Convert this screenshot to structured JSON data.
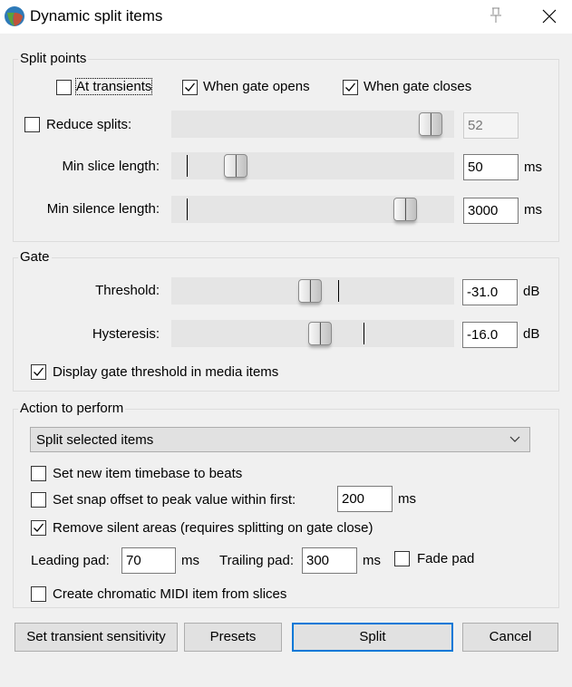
{
  "window": {
    "title": "Dynamic split items",
    "app_icon": "reaper-logo-icon",
    "pin_icon": "pin-icon",
    "close_icon": "close-icon"
  },
  "split_points": {
    "label": "Split points",
    "at_transients": {
      "label": "At transients",
      "checked": false
    },
    "when_gate_opens": {
      "label": "When gate opens",
      "checked": true
    },
    "when_gate_closes": {
      "label": "When gate closes",
      "checked": true
    },
    "reduce_splits": {
      "label": "Reduce splits:",
      "checked": false,
      "value": "52",
      "slider_fraction": 0.96
    },
    "min_slice_length": {
      "label": "Min slice length:",
      "value": "50",
      "unit": "ms",
      "slider_fraction": 0.2
    },
    "min_silence_length": {
      "label": "Min silence length:",
      "value": "3000",
      "unit": "ms",
      "slider_fraction": 0.86
    }
  },
  "gate": {
    "label": "Gate",
    "threshold": {
      "label": "Threshold:",
      "value": "-31.0",
      "unit": "dB",
      "slider_fraction": 0.49,
      "marker_fraction": 0.59
    },
    "hysteresis": {
      "label": "Hysteresis:",
      "value": "-16.0",
      "unit": "dB",
      "slider_fraction": 0.53,
      "marker_fraction": 0.68
    },
    "display_threshold": {
      "label": "Display gate threshold in media items",
      "checked": true
    }
  },
  "action": {
    "label": "Action to perform",
    "select_value": "Split selected items",
    "timebase_beats": {
      "label": "Set new item timebase to beats",
      "checked": false
    },
    "snap_offset": {
      "label": "Set snap offset to peak value within first:",
      "checked": false,
      "value": "200",
      "unit": "ms"
    },
    "remove_silent": {
      "label": "Remove silent areas (requires splitting on gate close)",
      "checked": true
    },
    "leading_pad": {
      "label": "Leading pad:",
      "value": "70",
      "unit": "ms"
    },
    "trailing_pad": {
      "label": "Trailing pad:",
      "value": "300",
      "unit": "ms"
    },
    "fade_pad": {
      "label": "Fade pad",
      "checked": false
    },
    "chromatic_midi": {
      "label": "Create chromatic MIDI item from slices",
      "checked": false
    }
  },
  "buttons": {
    "transient_sensitivity": "Set transient sensitivity",
    "presets": "Presets",
    "split": "Split",
    "cancel": "Cancel"
  },
  "colors": {
    "focus_blue": "#0078d7",
    "dialog_bg": "#f0f0f0",
    "track_bg": "#e5e5e5"
  }
}
